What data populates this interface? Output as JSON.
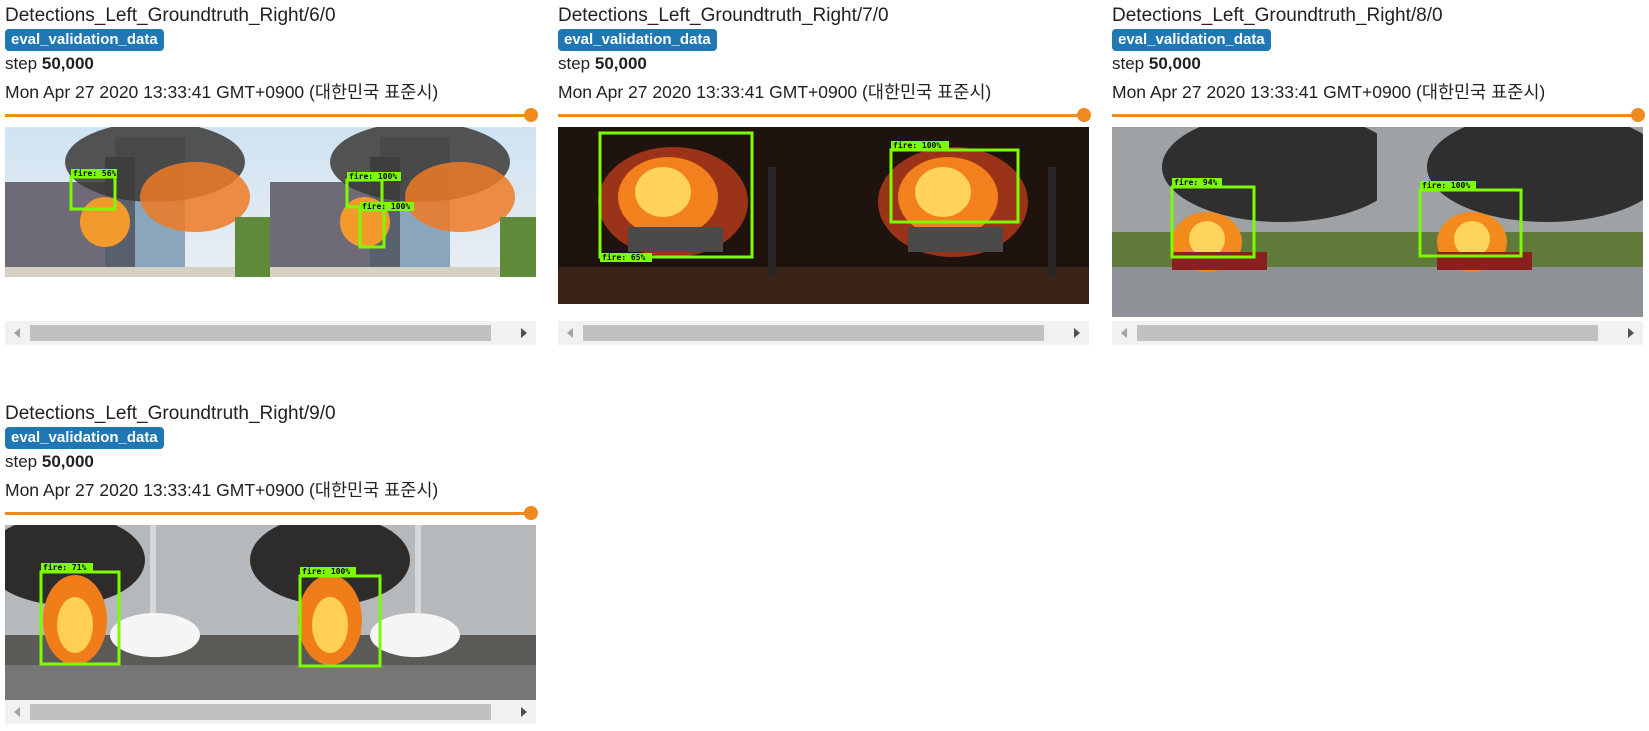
{
  "cards": [
    {
      "title": "Detections_Left_Groundtruth_Right/6/0",
      "run": "eval_validation_data",
      "step_label": "step",
      "step_value": "50,000",
      "timestamp": "Mon Apr 27 2020 13:33:41 GMT+0900 (대한민국 표준시)",
      "left_labels": [
        "fire: 56%"
      ],
      "right_labels": [
        "fire: 100%",
        "fire: 100%"
      ]
    },
    {
      "title": "Detections_Left_Groundtruth_Right/7/0",
      "run": "eval_validation_data",
      "step_label": "step",
      "step_value": "50,000",
      "timestamp": "Mon Apr 27 2020 13:33:41 GMT+0900 (대한민국 표준시)",
      "left_labels": [
        "fire: 65%"
      ],
      "right_labels": [
        "fire: 100%"
      ]
    },
    {
      "title": "Detections_Left_Groundtruth_Right/8/0",
      "run": "eval_validation_data",
      "step_label": "step",
      "step_value": "50,000",
      "timestamp": "Mon Apr 27 2020 13:33:41 GMT+0900 (대한민국 표준시)",
      "left_labels": [
        "fire: 94%"
      ],
      "right_labels": [
        "fire: 100%"
      ]
    },
    {
      "title": "Detections_Left_Groundtruth_Right/9/0",
      "run": "eval_validation_data",
      "step_label": "step",
      "step_value": "50,000",
      "timestamp": "Mon Apr 27 2020 13:33:41 GMT+0900 (대한민국 표준시)",
      "left_labels": [
        "fire: 71%"
      ],
      "right_labels": [
        "fire: 100%"
      ]
    }
  ],
  "colors": {
    "run_badge": "#1f77b4",
    "slider": "#ef8a1f",
    "detection_box": "#7cfc00"
  },
  "icons": {
    "scroll_left": "triangle-left",
    "scroll_right": "triangle-right"
  }
}
